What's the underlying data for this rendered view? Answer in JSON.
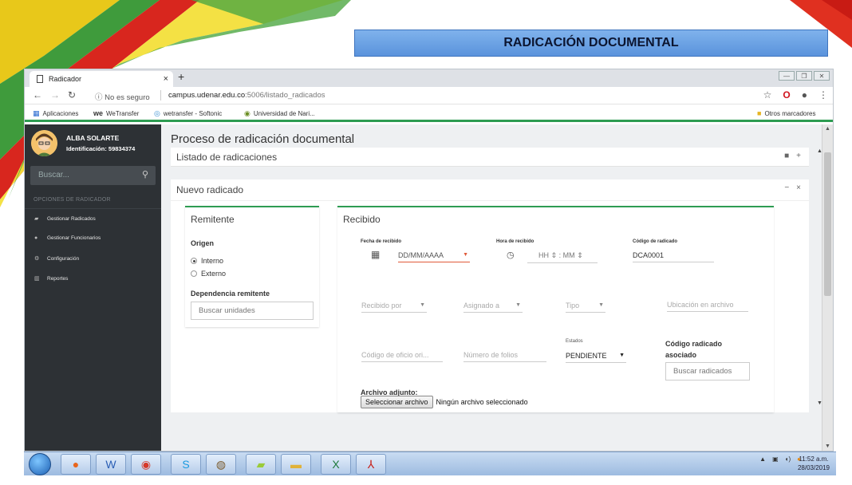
{
  "slide": {
    "title": "RADICACIÓN DOCUMENTAL"
  },
  "browser": {
    "tab_title": "Radicador",
    "tab_close": "×",
    "new_tab": "+",
    "url_security": "No es seguro",
    "url_host": "campus.udenar.edu.co",
    "url_path": ":5006/listado_radicados",
    "bookmarks": [
      {
        "label": "Aplicaciones",
        "icon": "apps-grid-icon"
      },
      {
        "label": "WeTransfer",
        "icon": "wetransfer-icon"
      },
      {
        "label": "wetransfer - Softonic",
        "icon": "softonic-icon"
      },
      {
        "label": "Universidad de Nari...",
        "icon": "university-icon"
      }
    ],
    "other_bookmarks": "Otros marcadores"
  },
  "sidebar": {
    "user_name": "ALBA SOLARTE",
    "user_id": "Identificación: 59834374",
    "search_placeholder": "Buscar...",
    "section_header": "OPCIONES DE RADICADOR",
    "items": [
      {
        "label": "Gestionar Radicados",
        "icon": "book-icon"
      },
      {
        "label": "Gestionar Funcionarios",
        "icon": "users-icon"
      },
      {
        "label": "Configuración",
        "icon": "gears-icon"
      },
      {
        "label": "Reportes",
        "icon": "bar-chart-icon"
      }
    ]
  },
  "main": {
    "page_title": "Proceso de radicación documental",
    "panel_list_title": "Listado de radicaciones",
    "panel_new_title": "Nuevo radicado",
    "remitente": {
      "title": "Remitente",
      "origen_label": "Origen",
      "options": [
        "Interno",
        "Externo"
      ],
      "selected": "Interno",
      "dependencia_label": "Dependencia remitente",
      "dependencia_placeholder": "Buscar unidades"
    },
    "recibido": {
      "title": "Recibido",
      "fecha_label": "Fecha de recibido",
      "fecha_placeholder": "DD/MM/AAAA",
      "hora_label": "Hora de recibido",
      "hora_hh": "HH",
      "hora_sep": ":",
      "hora_mm": "MM",
      "codigo_label": "Código de radicado",
      "codigo_value": "DCA0001",
      "recibido_por": "Recibido por",
      "asignado_a": "Asignado a",
      "tipo": "Tipo",
      "ubicacion": "Ubicación en archivo",
      "codigo_oficio": "Código de oficio ori...",
      "numero_folios": "Número de folios",
      "estados_label": "Estados",
      "estados_value": "PENDIENTE",
      "codigo_asociado_label_1": "Código radicado",
      "codigo_asociado_label_2": "asociado",
      "codigo_asociado_placeholder": "Buscar radicados",
      "archivo_label": "Archivo adjunto:",
      "archivo_button": "Seleccionar archivo",
      "archivo_status": "Ningún archivo seleccionado"
    }
  },
  "taskbar": {
    "apps": [
      "firefox",
      "word",
      "chrome",
      "skype",
      "network",
      "folder-green",
      "folder",
      "excel",
      "acrobat"
    ],
    "time": "11:52 a.m.",
    "date": "28/03/2019"
  }
}
